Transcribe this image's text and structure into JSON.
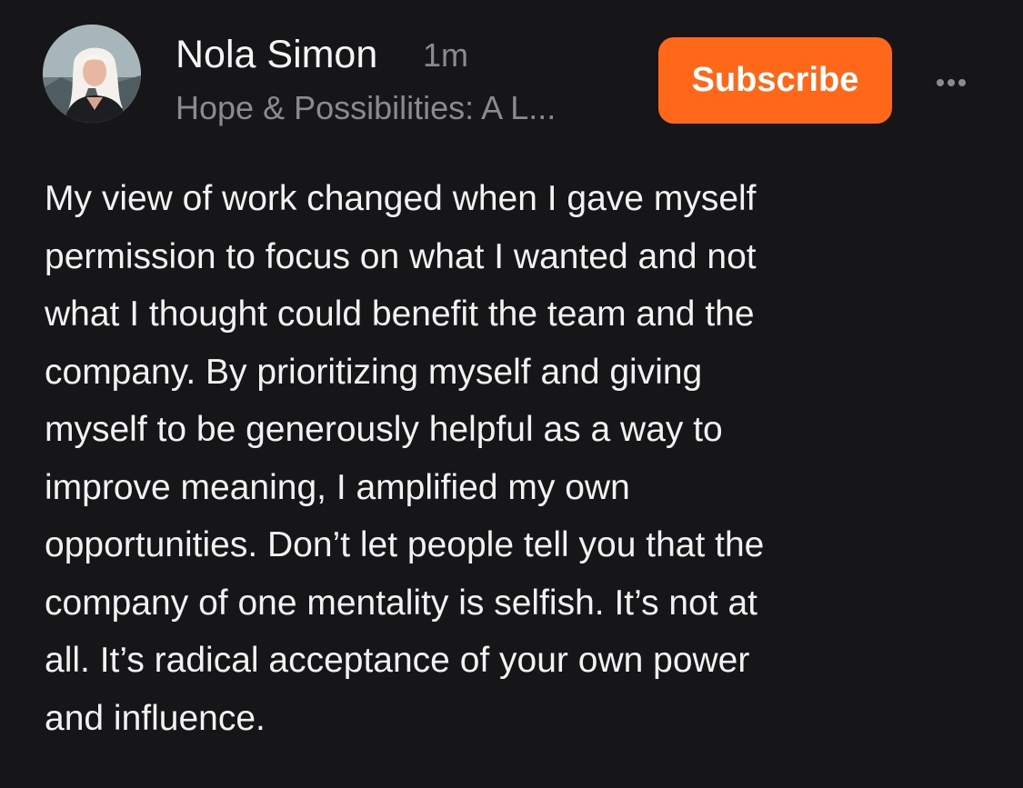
{
  "post": {
    "author_name": "Nola Simon",
    "time_ago": "1m",
    "publication": "Hope & Possibilities: A L...",
    "subscribe_label": "Subscribe",
    "more_icon": "more-horizontal-icon",
    "lines": [
      "My view of work changed when I gave myself",
      "permission to focus on what I wanted and not",
      "what I thought could benefit the team and the",
      "company. By prioritizing myself and giving",
      "myself to be generously helpful as a way to",
      "improve meaning, I amplified my own",
      "opportunities. Don’t let people tell you that the",
      "company of one mentality is selfish. It’s not at",
      "all. It’s radical acceptance of your own power",
      "and influence."
    ]
  },
  "colors": {
    "background": "#161618",
    "accent": "#ff6719",
    "text": "#f2f2f2",
    "muted": "#8b8b8f"
  }
}
